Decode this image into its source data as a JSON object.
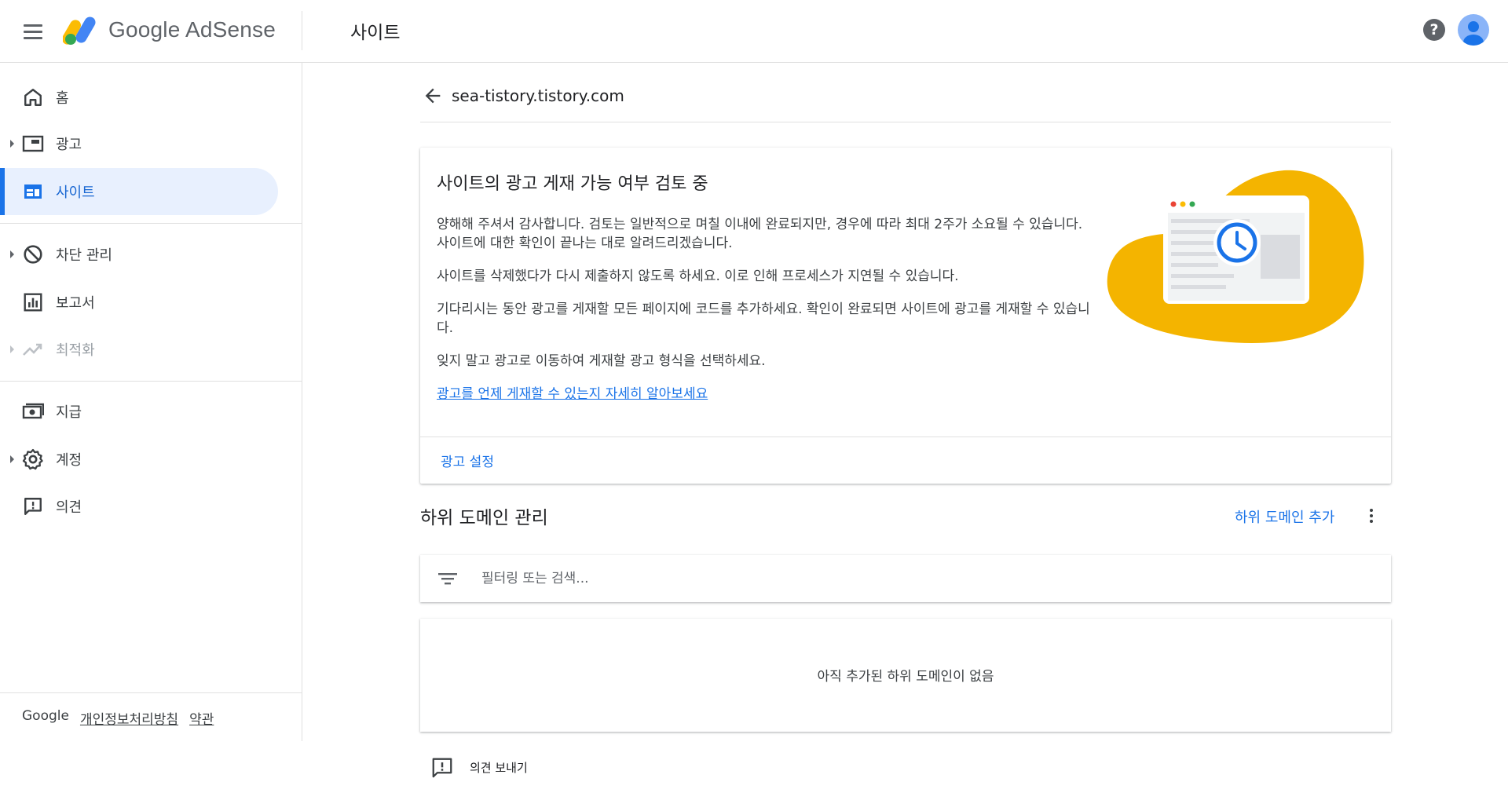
{
  "header": {
    "app_name_google": "Google",
    "app_name_product": "AdSense",
    "page_title": "사이트"
  },
  "sidebar": {
    "items": [
      {
        "label": "홈",
        "icon": "home-icon"
      },
      {
        "label": "광고",
        "icon": "ads-icon"
      },
      {
        "label": "사이트",
        "icon": "sites-icon"
      },
      {
        "label": "차단 관리",
        "icon": "block-icon"
      },
      {
        "label": "보고서",
        "icon": "reports-icon"
      },
      {
        "label": "최적화",
        "icon": "optimization-icon"
      },
      {
        "label": "지급",
        "icon": "payments-icon"
      },
      {
        "label": "계정",
        "icon": "gear-icon"
      },
      {
        "label": "의견",
        "icon": "feedback-icon"
      }
    ],
    "footer": {
      "brand": "Google",
      "privacy": "개인정보처리방침",
      "terms": "약관"
    }
  },
  "main": {
    "site_name": "sea-tistory.tistory.com",
    "review_card": {
      "title": "사이트의 광고 게재 가능 여부 검토 중",
      "paragraph_1": "양해해 주셔서 감사합니다. 검토는 일반적으로 며칠 이내에 완료되지만, 경우에 따라 최대 2주가 소요될 수 있습니다. 사이트에 대한 확인이 끝나는 대로 알려드리겠습니다.",
      "paragraph_2": "사이트를 삭제했다가 다시 제출하지 않도록 하세요. 이로 인해 프로세스가 지연될 수 있습니다.",
      "paragraph_3": "기다리시는 동안 광고를 게재할 모든 페이지에 코드를 추가하세요. 확인이 완료되면 사이트에 광고를 게재할 수 있습니다.",
      "paragraph_4": "잊지 말고 광고로 이동하여 게재할 광고 형식을 선택하세요.",
      "learn_more_link": "광고를 언제 게재할 수 있는지 자세히 알아보세요",
      "action_label": "광고 설정"
    },
    "subdomains": {
      "title": "하위 도메인 관리",
      "add_label": "하위 도메인 추가",
      "filter_placeholder": "필터링 또는 검색...",
      "empty_text": "아직 추가된 하위 도메인이 없음"
    },
    "feedback_label": "의견 보내기"
  },
  "colors": {
    "accent": "#1a73e8",
    "active_bg": "#e8f0fe",
    "illustration_blob": "#f4b400"
  }
}
